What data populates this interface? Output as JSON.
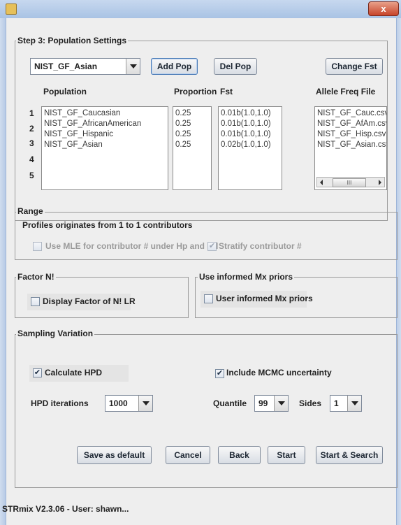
{
  "window": {
    "close_glyph": "x",
    "app_icon": "java-cup-icon"
  },
  "step3": {
    "legend": "Step 3: Population Settings",
    "population_select": "NIST_GF_Asian",
    "add_pop": "Add Pop",
    "del_pop": "Del Pop",
    "change_fst": "Change Fst",
    "headers": {
      "population": "Population",
      "proportion": "Proportion",
      "fst": "Fst",
      "allele": "Allele Freq File"
    },
    "row_numbers": [
      "1",
      "2",
      "3",
      "4",
      "5"
    ],
    "populations": [
      "NIST_GF_Caucasian",
      "NIST_GF_AfricanAmerican",
      "NIST_GF_Hispanic",
      "NIST_GF_Asian"
    ],
    "proportions": [
      "0.25",
      "0.25",
      "0.25",
      "0.25"
    ],
    "fst_values": [
      "0.01b(1.0,1.0)",
      "0.01b(1.0,1.0)",
      "0.01b(1.0,1.0)",
      "0.02b(1.0,1.0)"
    ],
    "allele_files": [
      "NIST_GF_Cauc.csv",
      "NIST_GF_AfAm.csv",
      "NIST_GF_Hisp.csv",
      "NIST_GF_Asian.csv"
    ],
    "scroll_thumb": "III"
  },
  "range": {
    "legend": "Range",
    "profiles_prefix": "Profiles originates from",
    "from": "1",
    "to_word": "to",
    "to": "1",
    "suffix": "contributors",
    "use_mle": "Use MLE for contributor # under Hp and Hd",
    "use_mle_checked": false,
    "stratify": "Stratify contributor #",
    "stratify_checked": true
  },
  "factor": {
    "legend": "Factor N!",
    "display": "Display Factor of N! LR",
    "display_checked": false
  },
  "mx": {
    "legend": "Use informed Mx priors",
    "user": "User informed Mx priors",
    "user_checked": false
  },
  "sampling": {
    "legend": "Sampling Variation",
    "calc_hpd": "Calculate HPD",
    "calc_hpd_checked": true,
    "include_mcmc": "Include MCMC uncertainty",
    "include_mcmc_checked": true,
    "hpd_iter_label": "HPD iterations",
    "hpd_iter_value": "1000",
    "quantile_label": "Quantile",
    "quantile_value": "99",
    "sides_label": "Sides",
    "sides_value": "1"
  },
  "buttons": {
    "save_default": "Save as default",
    "cancel": "Cancel",
    "back": "Back",
    "start": "Start",
    "start_search": "Start & Search"
  },
  "status": {
    "text": "STRmix V2.3.06 - User: shawn..."
  },
  "colors": {
    "title_bar": "#a9c3e4",
    "close": "#c7442a",
    "panel": "#eeeeee",
    "list_text": "#3a3a3a"
  }
}
